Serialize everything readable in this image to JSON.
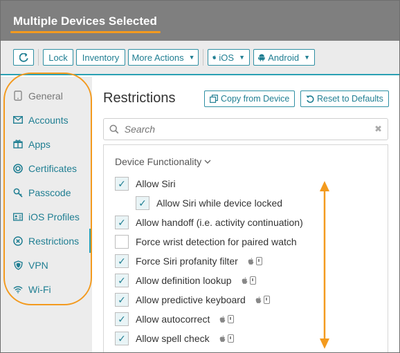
{
  "header": {
    "title": "Multiple Devices Selected",
    "accent_color": "#f39a1e"
  },
  "toolbar": {
    "refresh_icon": "refresh-icon",
    "lock_label": "Lock",
    "inventory_label": "Inventory",
    "more_actions_label": "More Actions",
    "ios_label": "iOS",
    "android_label": "Android"
  },
  "sidebar": {
    "items": [
      {
        "label": "General",
        "icon": "tablet-icon"
      },
      {
        "label": "Accounts",
        "icon": "envelope-icon"
      },
      {
        "label": "Apps",
        "icon": "apps-icon"
      },
      {
        "label": "Certificates",
        "icon": "certificate-icon"
      },
      {
        "label": "Passcode",
        "icon": "key-icon"
      },
      {
        "label": "iOS Profiles",
        "icon": "profile-icon"
      },
      {
        "label": "Restrictions",
        "icon": "restrictions-icon"
      },
      {
        "label": "VPN",
        "icon": "shield-icon"
      },
      {
        "label": "Wi-Fi",
        "icon": "wifi-icon"
      }
    ],
    "active_index": 6
  },
  "main": {
    "title": "Restrictions",
    "copy_label": "Copy from Device",
    "reset_label": "Reset to Defaults",
    "search_placeholder": "Search",
    "section_title": "Device Functionality",
    "options": [
      {
        "label": "Allow Siri",
        "checked": true
      },
      {
        "label": "Allow Siri while device locked",
        "checked": true
      },
      {
        "label": "Allow handoff (i.e. activity continuation)",
        "checked": true
      },
      {
        "label": "Force wrist detection for paired watch",
        "checked": false
      },
      {
        "label": "Force Siri profanity filter",
        "checked": true
      },
      {
        "label": "Allow definition lookup",
        "checked": true
      },
      {
        "label": "Allow predictive keyboard",
        "checked": true
      },
      {
        "label": "Allow autocorrect",
        "checked": true
      },
      {
        "label": "Allow spell check",
        "checked": true
      }
    ]
  },
  "colors": {
    "teal": "#1f7e92",
    "accent": "#2aa0b3",
    "highlight": "#f39a1e"
  }
}
